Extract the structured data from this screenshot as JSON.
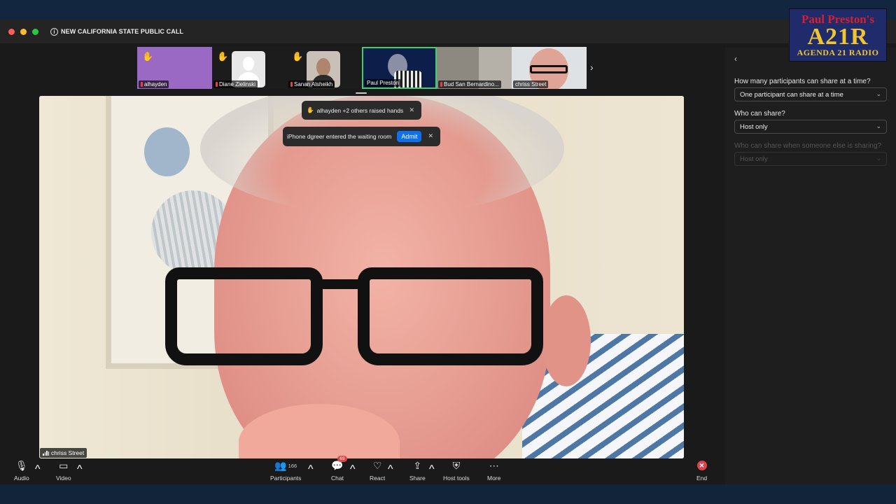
{
  "meeting": {
    "title": "NEW CALIFORNIA STATE PUBLIC CALL"
  },
  "logo": {
    "line1": "Paul Preston's",
    "line2": "A21R",
    "line3": "AGENDA 21 RADIO"
  },
  "thumbnails": [
    {
      "name": "alhayden",
      "raised_hand": true,
      "muted": true
    },
    {
      "name": "Diane Zielinski",
      "raised_hand": true,
      "muted": true
    },
    {
      "name": "Sanan Alsheikh",
      "raised_hand": true,
      "muted": true
    },
    {
      "name": "Paul Preston",
      "raised_hand": false,
      "muted": false,
      "active": true
    },
    {
      "name": "Bud   San Bernardino...",
      "raised_hand": false,
      "muted": true
    },
    {
      "name": "chriss Street",
      "raised_hand": false,
      "muted": false
    }
  ],
  "notifications": {
    "raised_hands": "alhayden +2 others raised hands",
    "waiting_room": "iPhone dgreer entered the waiting room",
    "admit_label": "Admit"
  },
  "speaker": {
    "name": "chriss Street"
  },
  "toolbar": {
    "audio": "Audio",
    "video": "Video",
    "participants": "Participants",
    "participants_count": "166",
    "chat": "Chat",
    "chat_badge": "69",
    "react": "React",
    "share": "Share",
    "host_tools": "Host tools",
    "more": "More",
    "end": "End"
  },
  "share_settings": {
    "q1": "How many participants can share at a time?",
    "q1_value": "One participant can share at a time",
    "q2": "Who can share?",
    "q2_value": "Host only",
    "q3": "Who can share when someone else is sharing?",
    "q3_value": "Host only"
  },
  "colors": {
    "accent": "#0e71eb",
    "active_border": "#3fcf6d",
    "alert": "#e0424a",
    "raise_hand": "#f1c232"
  }
}
